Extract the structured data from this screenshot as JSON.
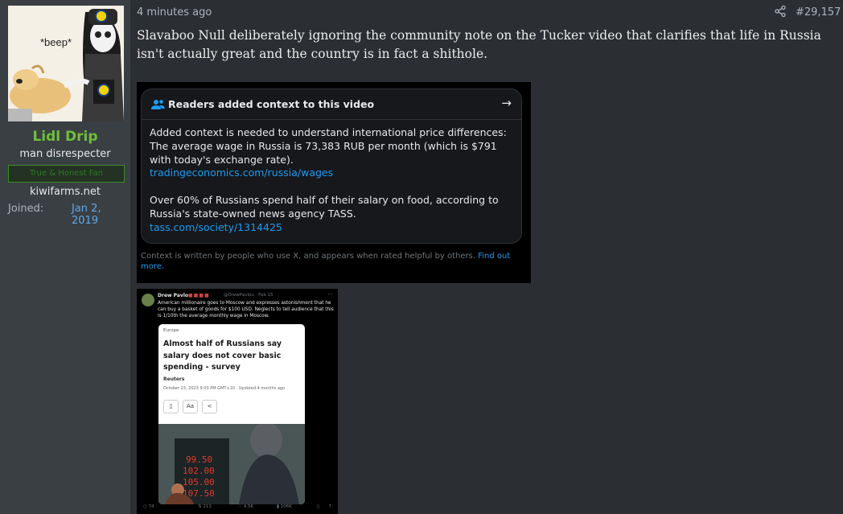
{
  "user": {
    "avatar_caption": "*beep*",
    "name": "Lidl Drip",
    "title": "man disrespecter",
    "banner": "True & Honest Fan",
    "site": "kiwifarms.net",
    "joined_label": "Joined:",
    "joined_date": "Jan 2, 2019"
  },
  "post": {
    "time": "4 minutes ago",
    "number": "#29,157",
    "message": "Slavaboo Null deliberately ignoring the community note on the Tucker video that clarifies that life in Russia isn't actually great and the country is in fact a shithole."
  },
  "community_note": {
    "header": "Readers added context to this video",
    "para1": "Added context is needed to understand international price differences: The average wage in Russia is 73,383 RUB per month (which is $791 with today's exchange rate).",
    "link1": "tradingeconomics.com/russia/wages",
    "para2": "Over 60% of Russians spend half of their salary on food, according to Russia's state-owned news agency TASS.",
    "link2": "tass.com/society/1314425",
    "footer": "Context is written by people who use X, and appears when rated helpful by others.",
    "footer_link": "Find out more."
  },
  "tweet": {
    "author": "Drew Pavlou",
    "handle": "@DrewPavlou · Feb 15",
    "text": "American millionaire goes to Moscow and expresses astonishment that he can buy a basket of goods for $100 USD. Neglects to tell audience that this is 1/10th the average monthly wage in Moscow.",
    "article": {
      "region": "Europe",
      "title": "Almost half of Russians say salary does not cover basic spending - survey",
      "source": "Reuters",
      "date": "October 23, 2023 9:03 PM GMT+10 · Updated 4 months ago",
      "font_btn": "Aa",
      "board": [
        "99.50",
        "102.00",
        "105.00",
        "107.50"
      ]
    },
    "replies": "74",
    "reposts": "213",
    "likes": "4.5K",
    "views": "106K"
  },
  "colors": {
    "username": "#6fbf3a",
    "link": "#5fa8e6",
    "x_link": "#1d9bf0"
  }
}
